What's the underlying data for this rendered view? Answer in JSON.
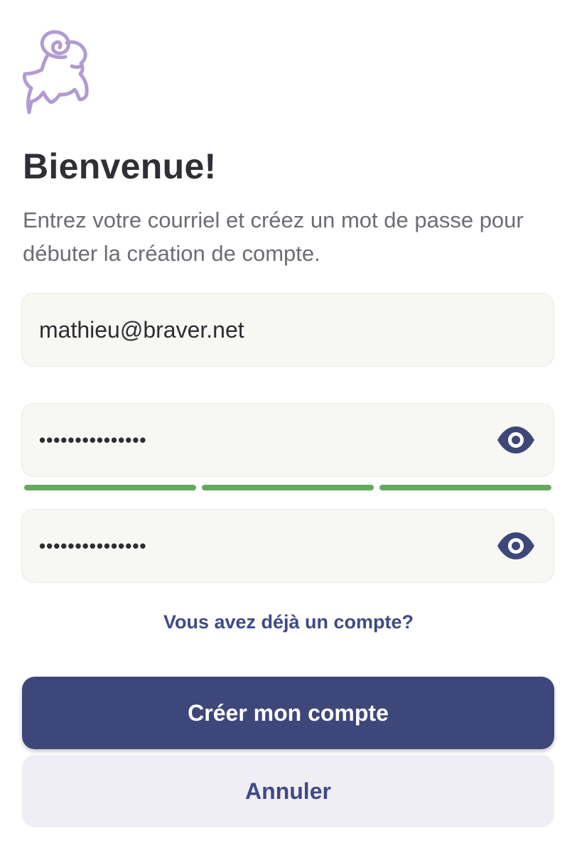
{
  "brand": {
    "logo_icon": "ram-outline-icon",
    "logo_color": "#b29bd4"
  },
  "heading": {
    "title": "Bienvenue!",
    "subtitle": "Entrez votre courriel et créez un mot de passe pour débuter la création de compte."
  },
  "form": {
    "email": {
      "value": "mathieu@braver.net",
      "icon": null
    },
    "password": {
      "value": "•••••••••••••••",
      "toggle_icon": "eye-icon",
      "strength": {
        "segments_filled": 3,
        "segments_total": 3,
        "color": "#63ab5a"
      }
    },
    "confirm_password": {
      "value": "•••••••••••••••",
      "toggle_icon": "eye-icon"
    }
  },
  "links": {
    "existing_account": "Vous avez déjà un compte?"
  },
  "actions": {
    "create_account": "Créer mon compte",
    "cancel": "Annuler"
  },
  "colors": {
    "primary": "#3e477a",
    "link": "#3f4a86",
    "field_background": "#f7f7f3",
    "secondary_button": "#f0eef5"
  }
}
